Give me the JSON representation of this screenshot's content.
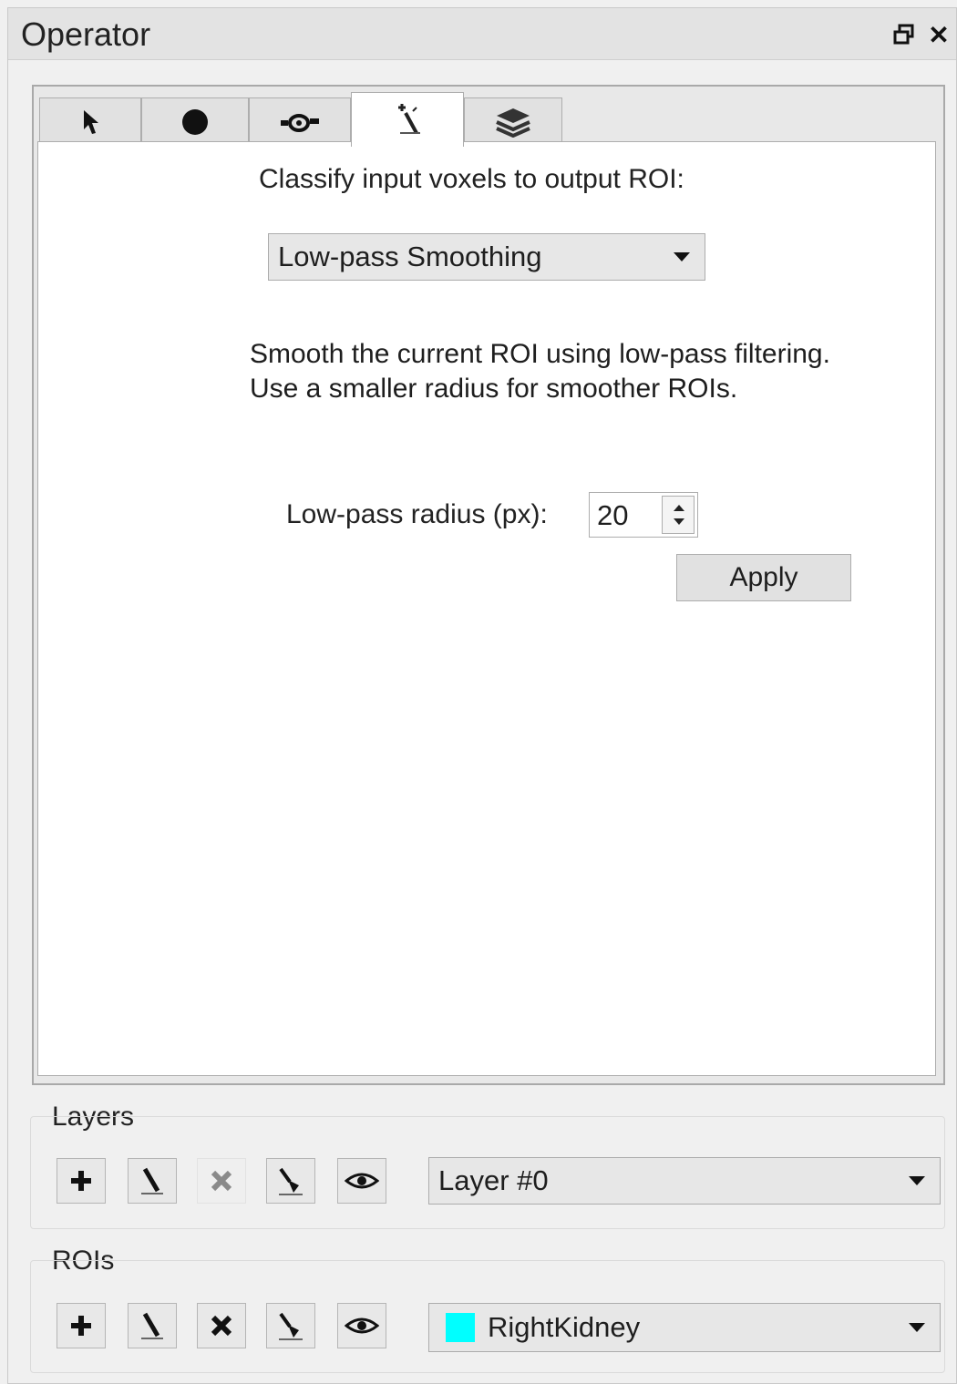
{
  "window": {
    "title": "Operator",
    "restore_icon": "restore-icon",
    "close_glyph": "✕"
  },
  "tabs": [
    {
      "icon": "pointer-icon",
      "active": false
    },
    {
      "icon": "dot-icon",
      "active": false
    },
    {
      "icon": "brush-icon",
      "active": false
    },
    {
      "icon": "wand-icon",
      "active": true
    },
    {
      "icon": "layers-stack-icon",
      "active": false
    }
  ],
  "operator": {
    "classify_label": "Classify input voxels to output ROI:",
    "method_value": "Low-pass Smoothing",
    "description": "Smooth the current ROI using low-pass filtering.  Use a smaller radius for smoother ROIs.",
    "radius_label": "Low-pass radius (px):",
    "radius_value": "20",
    "apply_label": "Apply"
  },
  "layers": {
    "title": "Layers",
    "selected": "Layer #0",
    "delete_enabled": false
  },
  "rois": {
    "title": "ROIs",
    "selected": "RightKidney",
    "color": "#00ffff",
    "delete_enabled": true
  }
}
